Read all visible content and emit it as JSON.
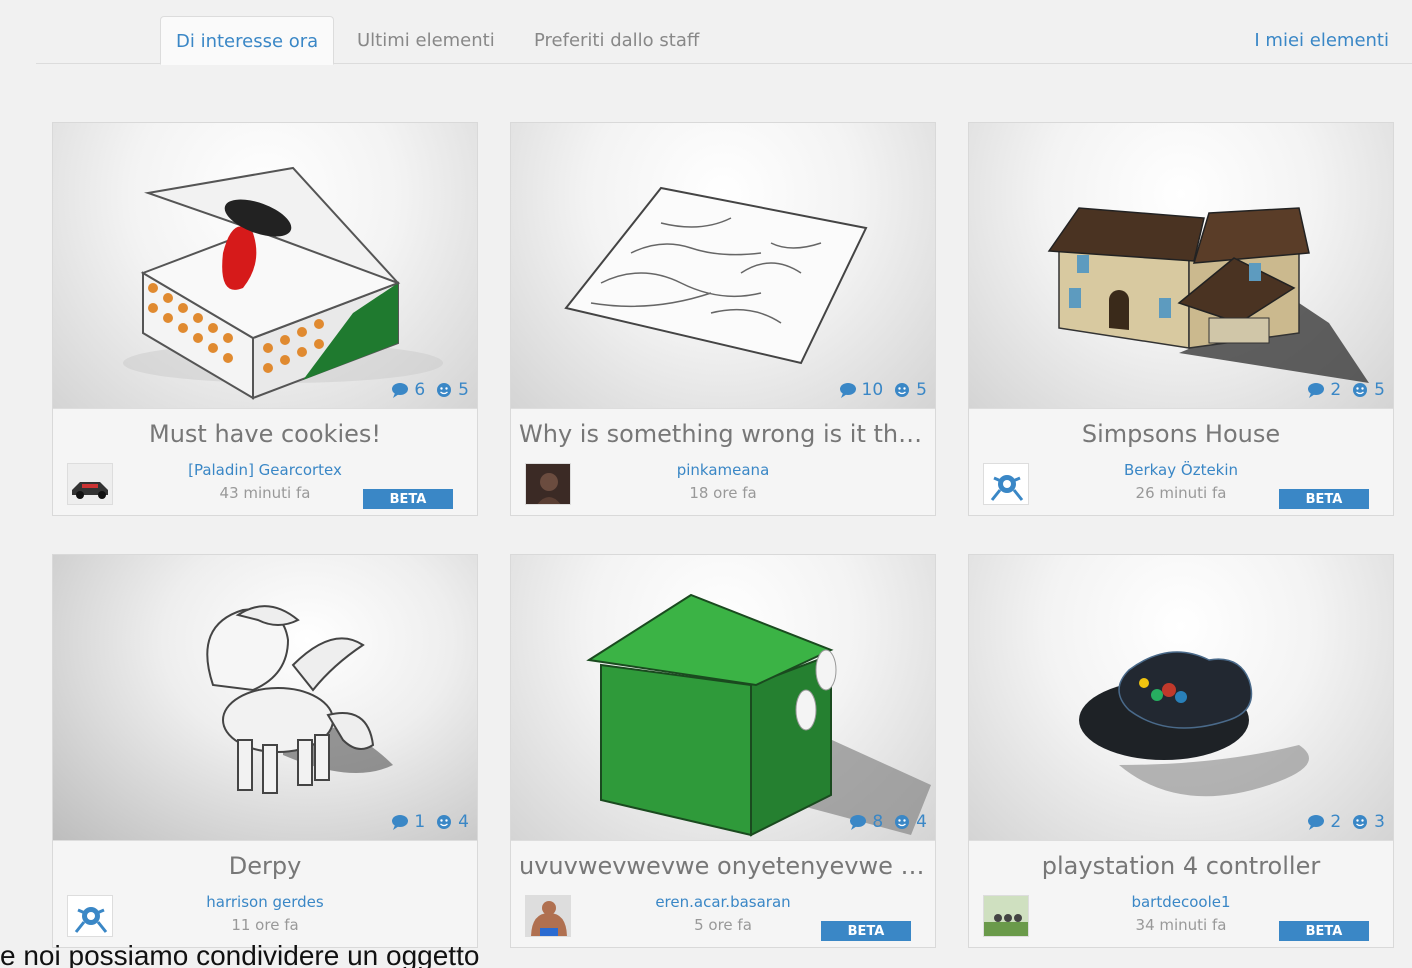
{
  "tabs": [
    {
      "label": "Di interesse ora",
      "active": true
    },
    {
      "label": "Ultimi elementi",
      "active": false
    },
    {
      "label": "Preferiti dallo staff",
      "active": false
    }
  ],
  "my_items_label": "I miei elementi",
  "cards": [
    {
      "title": "Must have cookies!",
      "author": "[Paladin] Gearcortex",
      "time": "43 minuti fa",
      "comments": "6",
      "likes": "5",
      "beta": "BETA"
    },
    {
      "title": "Why is something wrong is it that ...",
      "author": "pinkameana",
      "time": "18 ore fa",
      "comments": "10",
      "likes": "5"
    },
    {
      "title": "Simpsons House",
      "author": "Berkay Öztekin",
      "time": "26 minuti fa",
      "comments": "2",
      "likes": "5",
      "beta": "BETA"
    },
    {
      "title": "Derpy",
      "author": "harrison gerdes",
      "time": "11 ore fa",
      "comments": "1",
      "likes": "4"
    },
    {
      "title": "uvuvwevwevwe onyetenyevwe ug...",
      "author": "eren.acar.basaran",
      "time": "5 ore fa",
      "comments": "8",
      "likes": "4",
      "beta": "BETA"
    },
    {
      "title": "playstation 4 controller",
      "author": "bartdecoole1",
      "time": "34 minuti fa",
      "comments": "2",
      "likes": "3",
      "beta": "BETA"
    }
  ],
  "caption": "e noi possiamo condividere un oggetto"
}
